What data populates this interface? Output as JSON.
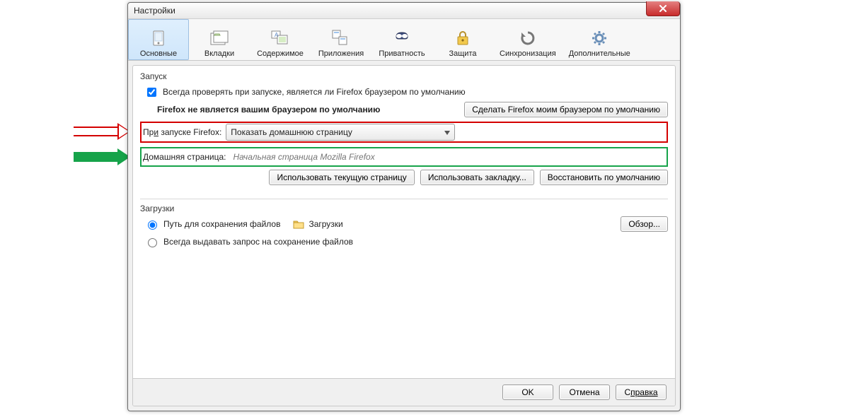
{
  "window": {
    "title": "Настройки"
  },
  "tabs": [
    {
      "key": "general",
      "label": "Основные"
    },
    {
      "key": "tabs",
      "label": "Вкладки"
    },
    {
      "key": "content",
      "label": "Содержимое"
    },
    {
      "key": "applications",
      "label": "Приложения"
    },
    {
      "key": "privacy",
      "label": "Приватность"
    },
    {
      "key": "security",
      "label": "Защита"
    },
    {
      "key": "sync",
      "label": "Синхронизация"
    },
    {
      "key": "advanced",
      "label": "Дополнительные"
    }
  ],
  "startup": {
    "title": "Запуск",
    "check_default_label": "Всегда проверять при запуске, является ли Firefox браузером по умолчанию",
    "not_default_text": "Firefox не является вашим браузером по умолчанию",
    "make_default_btn": "Сделать Firefox моим браузером по умолчанию",
    "on_launch_label_pre": "Пр",
    "on_launch_label_und": "и",
    "on_launch_label_post": " запуске Firefox:",
    "on_launch_value": "Показать домашнюю страницу",
    "homepage_label": "Домашняя страница:",
    "homepage_placeholder": "Начальная страница Mozilla Firefox",
    "use_current_btn": "Использовать текущую страницу",
    "use_bookmark_btn": "Использовать закладку...",
    "restore_default_btn": "Восстановить по умолчанию"
  },
  "downloads": {
    "title": "Загрузки",
    "save_to_label": "Путь для сохранения файлов",
    "save_to_value": "Загрузки",
    "browse_btn": "Обзор...",
    "always_ask_label": "Всегда выдавать запрос на сохранение файлов"
  },
  "footer": {
    "ok": "OK",
    "cancel": "Отмена",
    "help_pre": "С",
    "help_und": "правка"
  }
}
